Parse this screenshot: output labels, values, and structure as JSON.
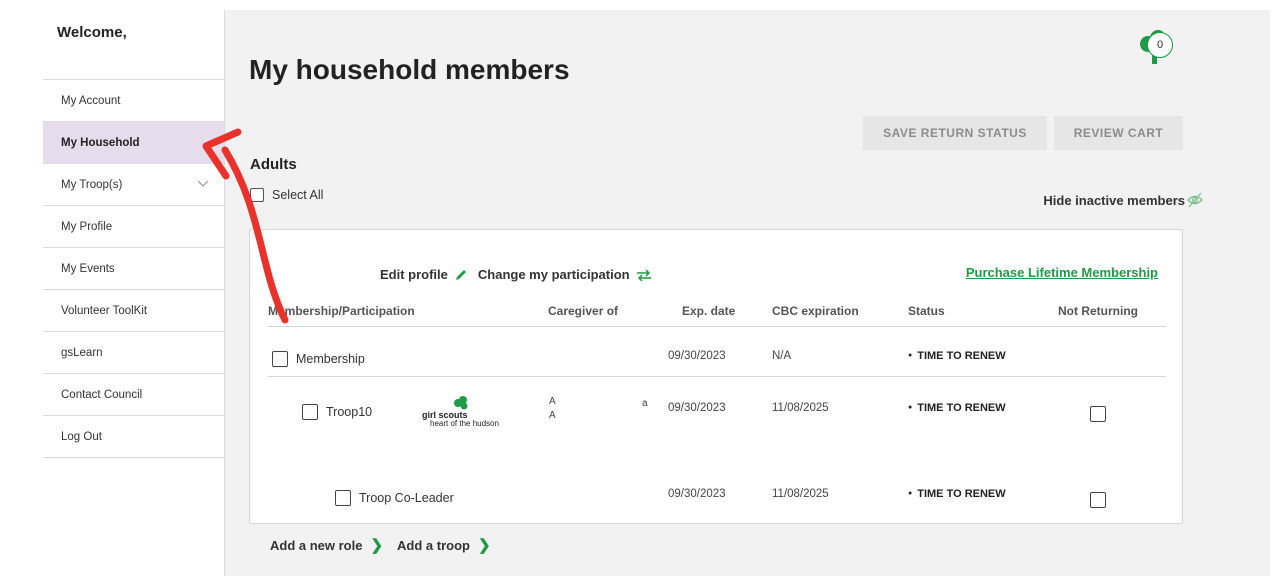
{
  "sidebar": {
    "welcome": "Welcome,",
    "items": [
      {
        "label": "My Account"
      },
      {
        "label": "My Household",
        "active": true
      },
      {
        "label": "My Troop(s)",
        "has_chevron": true
      },
      {
        "label": "My Profile"
      },
      {
        "label": "My Events"
      },
      {
        "label": "Volunteer ToolKit"
      },
      {
        "label": "gsLearn"
      },
      {
        "label": "Contact Council"
      },
      {
        "label": "Log Out"
      }
    ]
  },
  "header": {
    "title": "My household members",
    "cart_count": "0"
  },
  "buttons": {
    "save_return_status": "SAVE RETURN STATUS",
    "review_cart": "REVIEW CART"
  },
  "adults": {
    "heading": "Adults",
    "select_all": "Select All",
    "hide_inactive": "Hide inactive members"
  },
  "card": {
    "edit_profile": "Edit profile",
    "change_participation": "Change my participation",
    "purchase_lifetime": "Purchase Lifetime Membership",
    "columns": [
      "Membership/Participation",
      "Caregiver of",
      "Exp. date",
      "CBC expiration",
      "Status",
      "Not Returning"
    ],
    "rows": [
      {
        "label": "Membership",
        "exp": "09/30/2023",
        "cbc": "N/A",
        "status": "TIME TO RENEW"
      },
      {
        "label": "Troop10",
        "exp": "09/30/2023",
        "cbc": "11/08/2025",
        "status": "TIME TO RENEW",
        "logo_line1": "girl scouts",
        "logo_line2": "heart of the hudson",
        "caregiver_a": "A",
        "caregiver_b": "A",
        "caregiver_c": "a"
      },
      {
        "label": "Troop Co-Leader",
        "exp": "09/30/2023",
        "cbc": "11/08/2025",
        "status": "TIME TO RENEW"
      }
    ]
  },
  "bottom": {
    "add_role": "Add a new role",
    "add_troop": "Add a troop"
  },
  "colors": {
    "accent_green": "#1f9a46",
    "active_nav": "#e7dcec",
    "annotation_red": "#e8322b"
  }
}
